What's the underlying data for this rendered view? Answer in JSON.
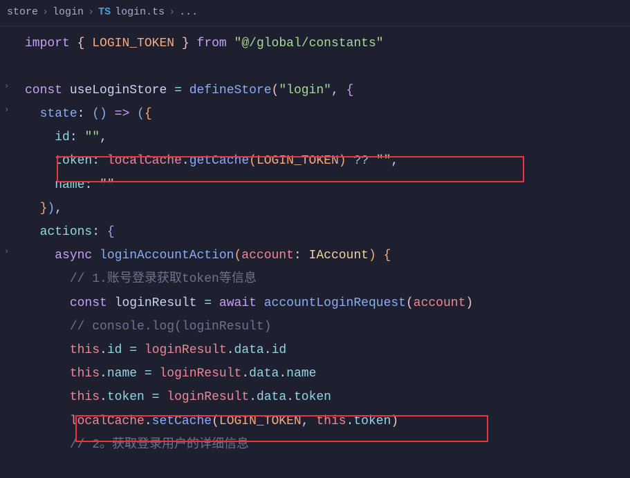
{
  "breadcrumb": {
    "store": "store",
    "login": "login",
    "file": "login.ts",
    "symbol": "..."
  },
  "code": {
    "l1_import": "import",
    "l1_br1": "{",
    "l1_token": "LOGIN_TOKEN",
    "l1_br2": "}",
    "l1_from": "from",
    "l1_path": "\"@/global/constants\"",
    "l2_const": "const",
    "l2_name": "useLoginStore",
    "l2_eq": "=",
    "l2_fn": "defineStore",
    "l2_arg": "\"login\"",
    "l3_state": "state",
    "l3_arrow": "() => ({",
    "l4_id": "id",
    "l4_val": "\"\"",
    "l5_token": "token",
    "l5_local": "localCache",
    "l5_get": "getCache",
    "l5_arg": "LOGIN_TOKEN",
    "l5_nullish": "??",
    "l5_fallback": "\"\"",
    "l6_name": "name",
    "l6_val": "\"\"",
    "l7_close": "}),",
    "l8_actions": "actions",
    "l9_async": "async",
    "l9_fn": "loginAccountAction",
    "l9_param": "account",
    "l9_type": "IAccount",
    "l10_com": "// 1.账号登录获取token等信息",
    "l11_const": "const",
    "l11_res": "loginResult",
    "l11_await": "await",
    "l11_fn": "accountLoginRequest",
    "l11_arg": "account",
    "l12_com": "// console.log(loginResult)",
    "l13_this": "this",
    "l13_id": "id",
    "l13_res": "loginResult",
    "l13_data": "data",
    "l14_name": "name",
    "l15_token": "token",
    "l16_local": "localCache",
    "l16_set": "setCache",
    "l16_arg1": "LOGIN_TOKEN",
    "l16_this": "this",
    "l16_tok": "token",
    "l17_com": "// 2。获取登录用户的详细信息"
  }
}
